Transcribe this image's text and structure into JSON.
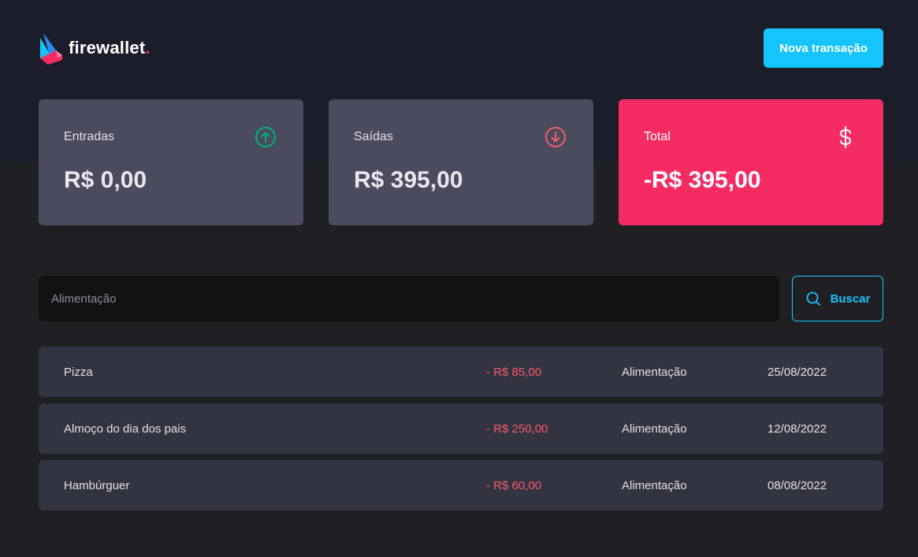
{
  "brand": {
    "name": "firewallet",
    "dot": ".",
    "accent": "#f52c64"
  },
  "header": {
    "new_transaction_label": "Nova transação"
  },
  "summary": {
    "income": {
      "label": "Entradas",
      "value": "R$ 0,00",
      "icon": "arrow-circle-up-icon",
      "icon_color": "#00b37e"
    },
    "outcome": {
      "label": "Saídas",
      "value": "R$ 395,00",
      "icon": "arrow-circle-down-icon",
      "icon_color": "#f75a68"
    },
    "total": {
      "label": "Total",
      "value": "-R$ 395,00",
      "icon": "currency-dollar-icon",
      "bg_color": "#f52c64"
    }
  },
  "search": {
    "placeholder": "Alimentação",
    "value": "",
    "button_label": "Buscar",
    "icon": "search-icon"
  },
  "transactions": [
    {
      "description": "Pizza",
      "price": "- R$ 85,00",
      "category": "Alimentação",
      "date": "25/08/2022"
    },
    {
      "description": "Almoço do dia dos pais",
      "price": "- R$ 250,00",
      "category": "Alimentação",
      "date": "12/08/2022"
    },
    {
      "description": "Hambúrguer",
      "price": "- R$ 60,00",
      "category": "Alimentação",
      "date": "08/08/2022"
    }
  ],
  "colors": {
    "primary": "#17c3fb",
    "background": "#202024",
    "header_background": "#1b1e2a",
    "card": "#4a4b5f",
    "row": "#323442"
  }
}
